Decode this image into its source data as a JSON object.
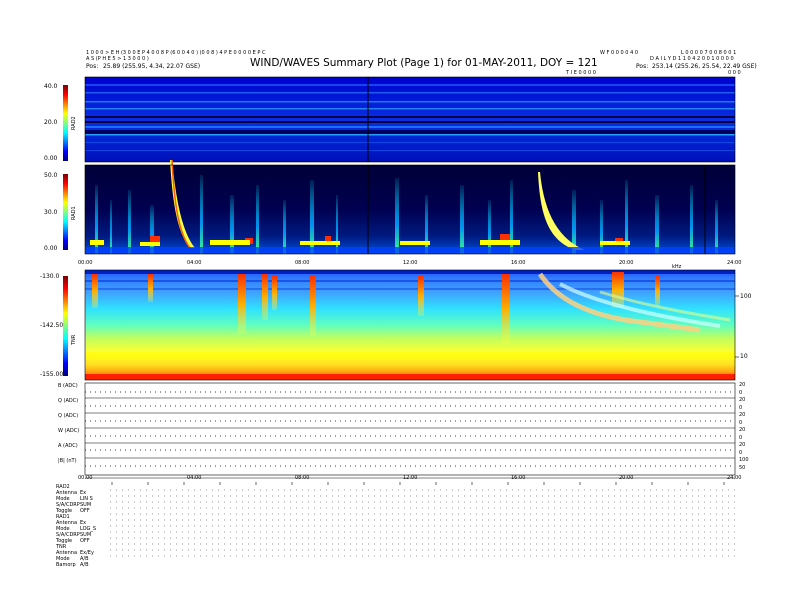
{
  "header": {
    "title": "WIND/WAVES Summary Plot (Page 1) for 01-MAY-2011, DOY = 121",
    "left_line1": "1 0 0 0 > E H (3 0 0 E P 4 0 0 8 P (6 0 0 4 0 ) (0 0 8 ) 4 P E 0 0 0 0 E P C",
    "left_line2": "A S (P H E 5 > 1 3 0 0 0 )",
    "left_line3": "Pos:",
    "left_pos": "25.89 (255.95, 4.34, 22.07 GSE)",
    "right_code": "W F 0 0 0 0 4 0",
    "right_id": "L 0 0 0 0 7 0 0 8 0 0 1",
    "right_line2": "D A I L Y  D 1 1 0 4 2 0 0 1 0 0 0 0",
    "right_line3": "Pos:",
    "right_pos": "253.14 (255.26, 25.54, 22.49 GSE)",
    "time_left": "T I E 0 0 0 0",
    "time_right": "0 0 0"
  },
  "panels": {
    "rad2": {
      "label": "RAD2",
      "ticks": [
        "40.0",
        "20.0",
        "0.00"
      ]
    },
    "rad1": {
      "label": "RAD1",
      "ticks": [
        "50.0",
        "30.0",
        "0.00"
      ]
    },
    "tnr": {
      "label": "TNR",
      "ticks": [
        "-130.0",
        "-142.50",
        "-155.00"
      ],
      "right_ticks": [
        "100",
        "10"
      ],
      "right_label": "kHz"
    },
    "mid_time_ticks": [
      "00:00",
      "04:00",
      "08:00",
      "12:00",
      "16:00",
      "20:00",
      "24:00"
    ],
    "mid_time_label": "UT (h)"
  },
  "traces": {
    "labels": [
      "B (ADC)",
      "Q (ADC)",
      "Q (ADC)",
      "W (ADC)",
      "A (ADC)",
      "|B| (nT)"
    ],
    "right_ticks": [
      [
        "20",
        "0"
      ],
      [
        "20",
        "0"
      ],
      [
        "20",
        "0"
      ],
      [
        "20",
        "0"
      ],
      [
        "20",
        "0"
      ],
      [
        "100",
        "50"
      ]
    ],
    "time_ticks": [
      "00:00",
      "04:00",
      "08:00",
      "12:00",
      "16:00",
      "20:00",
      "24:00"
    ]
  },
  "status": {
    "blocks": [
      {
        "name": "RAD2",
        "rows": [
          [
            "Antenna",
            "Ex"
          ],
          [
            "Mode",
            "LIN S"
          ],
          [
            "S/A/CDRP",
            "SUM"
          ],
          [
            "Toggle",
            "OFF"
          ]
        ]
      },
      {
        "name": "RAD1",
        "rows": [
          [
            "Antenna",
            "Ex"
          ],
          [
            "Mode",
            "LOG_S"
          ],
          [
            "S/A/CDRP",
            "SUM"
          ],
          [
            "Toggle",
            "OFF"
          ]
        ]
      },
      {
        "name": "TNR",
        "rows": [
          [
            "Antenna",
            "Ex/Ey"
          ],
          [
            "Mode",
            "A/B"
          ],
          [
            "Bamorp",
            "A/B"
          ]
        ]
      }
    ]
  },
  "chart_data": [
    {
      "type": "heatmap",
      "title": "RAD2",
      "ylabel": "RAD2",
      "ylim": [
        0,
        40
      ],
      "x": "00:00-24:00 UT",
      "colorbar": [
        "#7a0000",
        "#ff0000",
        "#ff8000",
        "#ffff00",
        "#80ff80",
        "#00ffff",
        "#0080ff",
        "#0000ff",
        "#000080"
      ]
    },
    {
      "type": "heatmap",
      "title": "RAD1",
      "ylabel": "RAD1",
      "ylim": [
        0,
        50
      ],
      "x": "00:00-24:00 UT"
    },
    {
      "type": "heatmap",
      "title": "TNR",
      "ylabel": "TNR",
      "ylim": [
        -155,
        -130
      ],
      "x": "00:00-24:00 UT"
    },
    {
      "type": "line",
      "series": [
        {
          "name": "B (ADC)"
        },
        {
          "name": "Q (ADC)"
        },
        {
          "name": "Q (ADC)"
        },
        {
          "name": "W (ADC)"
        },
        {
          "name": "A (ADC)"
        },
        {
          "name": "|B| (nT)"
        }
      ],
      "x": [
        "00:00",
        "04:00",
        "08:00",
        "12:00",
        "16:00",
        "20:00",
        "24:00"
      ]
    }
  ]
}
